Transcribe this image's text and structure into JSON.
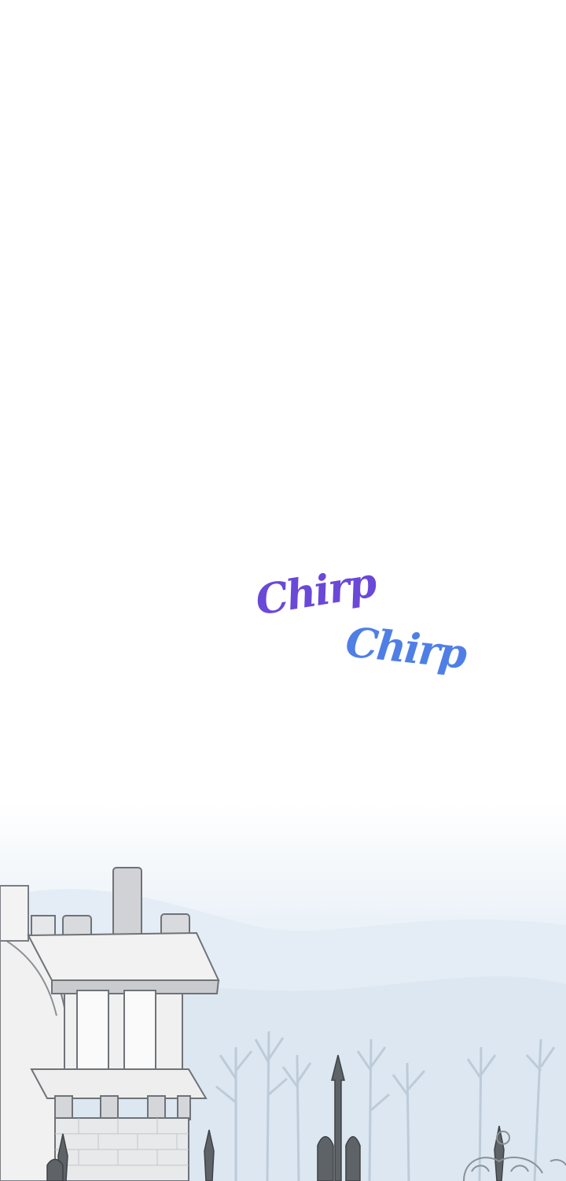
{
  "sound_effects": [
    {
      "text": "Chirp",
      "color": "#6a48d8"
    },
    {
      "text": "Chirp",
      "color": "#4f7fe6"
    }
  ],
  "scene": {
    "description_icon": "castle-tower-illustration",
    "palette": {
      "stone": "#eeeeee",
      "shadow": "#b9bcc0",
      "outline": "#6f7378",
      "mist": "#d6e3ef",
      "trees": "#aebfce"
    }
  }
}
